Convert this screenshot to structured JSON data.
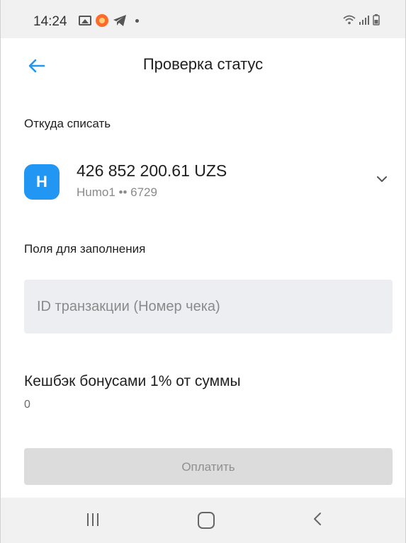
{
  "status_bar": {
    "time": "14:24"
  },
  "header": {
    "title": "Проверка статус"
  },
  "source": {
    "label": "Откуда списать",
    "amount": "426 852 200.61 UZS",
    "card": "Humo1  •• 6729",
    "logo_letter": "H"
  },
  "fields": {
    "label": "Поля для заполнения",
    "transaction_id_placeholder": "ID транзакции (Номер чека)"
  },
  "cashback": {
    "label": "Кешбэк бонусами 1% от суммы",
    "value": "0"
  },
  "actions": {
    "pay_label": "Оплатить"
  },
  "colors": {
    "accent": "#2196f3",
    "disabled_button": "#dcdcdc",
    "input_bg": "#eceef2"
  }
}
